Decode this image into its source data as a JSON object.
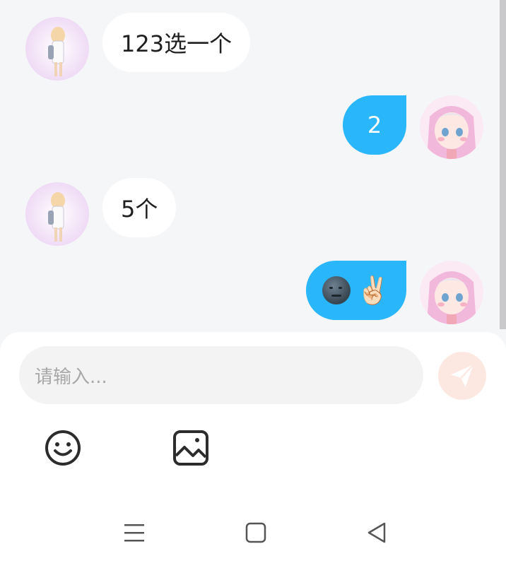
{
  "messages": [
    {
      "side": "in",
      "text": "123选一个"
    },
    {
      "side": "out",
      "text": "2"
    },
    {
      "side": "in",
      "text": "5个"
    },
    {
      "side": "out",
      "emojis": [
        "new-moon-face-emoji",
        "victory-hand-emoji"
      ]
    }
  ],
  "emoji_chars": {
    "victory": "✌🏻"
  },
  "composer": {
    "placeholder": "请输入..."
  },
  "colors": {
    "outgoing_bubble": "#29b6fb",
    "incoming_bubble": "#ffffff",
    "send_button": "#fde7e1",
    "send_icon": "#ffffff"
  },
  "icons": {
    "toolbar": [
      "emoji-face-icon",
      "image-icon"
    ],
    "nav": [
      "menu-icon",
      "home-square-icon",
      "back-triangle-icon"
    ]
  }
}
